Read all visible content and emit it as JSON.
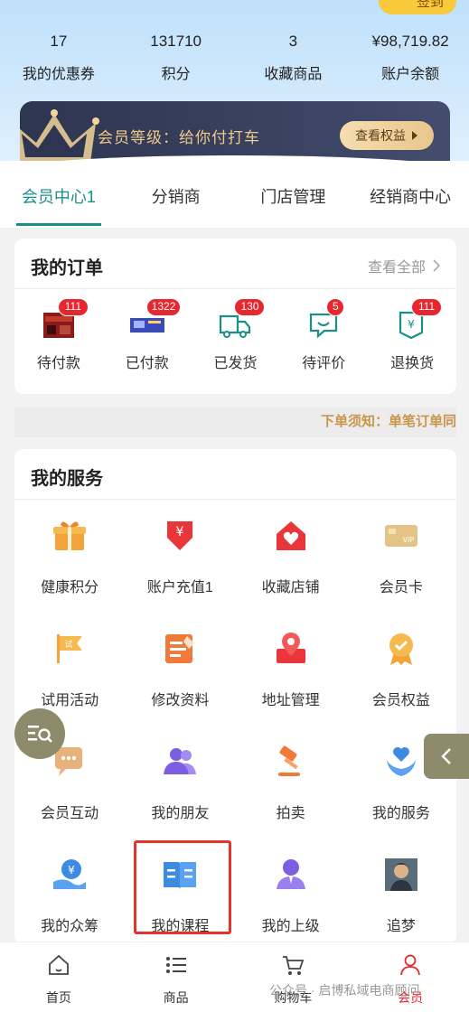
{
  "header": {
    "signin_label": "签到",
    "stats": [
      {
        "value": "17",
        "label": "我的优惠券"
      },
      {
        "value": "131710",
        "label": "积分"
      },
      {
        "value": "3",
        "label": "收藏商品"
      },
      {
        "value": "¥98,719.82",
        "label": "账户余额"
      }
    ],
    "member_level_text": "会员等级：给你付打车",
    "benefit_button": "查看权益"
  },
  "tabs": [
    {
      "label": "会员中心1",
      "active": true
    },
    {
      "label": "分销商",
      "active": false
    },
    {
      "label": "门店管理",
      "active": false
    },
    {
      "label": "经销商中心",
      "active": false
    }
  ],
  "orders": {
    "title": "我的订单",
    "see_all": "查看全部",
    "items": [
      {
        "label": "待付款",
        "badge": "111",
        "icon": "product-thumb-icon"
      },
      {
        "label": "已付款",
        "badge": "1322",
        "icon": "product-thumb-icon"
      },
      {
        "label": "已发货",
        "badge": "130",
        "icon": "truck-icon"
      },
      {
        "label": "待评价",
        "badge": "5",
        "icon": "chat-smile-icon"
      },
      {
        "label": "退换货",
        "badge": "111",
        "icon": "refund-icon"
      }
    ]
  },
  "notice": "下单须知：单笔订单同",
  "services": {
    "title": "我的服务",
    "items": [
      {
        "label": "健康积分",
        "icon": "gift-icon"
      },
      {
        "label": "账户充值1",
        "icon": "recharge-icon"
      },
      {
        "label": "收藏店铺",
        "icon": "favorite-shop-icon"
      },
      {
        "label": "会员卡",
        "icon": "vip-card-icon"
      },
      {
        "label": "试用活动",
        "icon": "trial-flag-icon"
      },
      {
        "label": "修改资料",
        "icon": "edit-profile-icon"
      },
      {
        "label": "地址管理",
        "icon": "location-icon"
      },
      {
        "label": "会员权益",
        "icon": "medal-icon"
      },
      {
        "label": "会员互动",
        "icon": "interaction-icon"
      },
      {
        "label": "我的朋友",
        "icon": "friends-icon"
      },
      {
        "label": "拍卖",
        "icon": "auction-hammer-icon"
      },
      {
        "label": "我的服务",
        "icon": "service-hands-icon"
      },
      {
        "label": "我的众筹",
        "icon": "crowdfunding-icon"
      },
      {
        "label": "我的课程",
        "icon": "book-icon"
      },
      {
        "label": "我的上级",
        "icon": "superior-user-icon"
      },
      {
        "label": "追梦",
        "icon": "avatar-thumb-icon"
      }
    ]
  },
  "bottom_nav": [
    {
      "label": "首页",
      "icon": "home-icon",
      "active": false
    },
    {
      "label": "商品",
      "icon": "list-icon",
      "active": false
    },
    {
      "label": "购物车",
      "icon": "cart-icon",
      "active": false
    },
    {
      "label": "会员",
      "icon": "user-icon",
      "active": true
    }
  ],
  "watermark": "公众号 · 启博私域电商顾问",
  "colors": {
    "accent": "#1a8f8a",
    "badge": "#e8262f",
    "member_gold": "#f0c987",
    "highlight": "#e4332f"
  }
}
